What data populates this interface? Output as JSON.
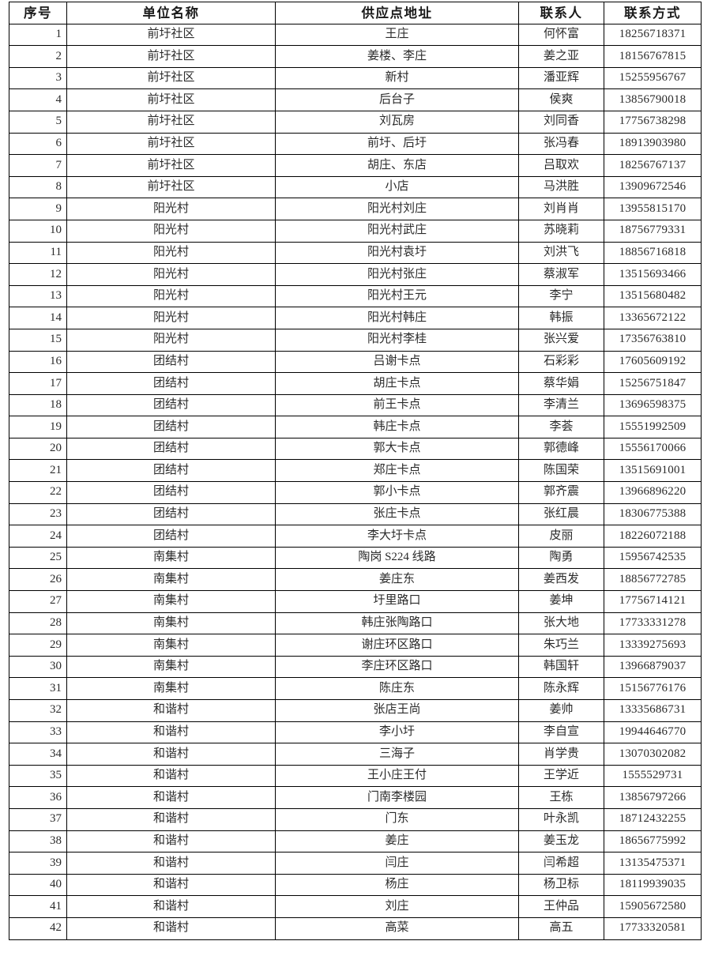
{
  "document": {
    "type": "table",
    "columns": [
      {
        "key": "seq",
        "label": "序号"
      },
      {
        "key": "unit",
        "label": "单位名称"
      },
      {
        "key": "addr",
        "label": "供应点地址"
      },
      {
        "key": "person",
        "label": "联系人"
      },
      {
        "key": "phone",
        "label": "联系方式"
      }
    ],
    "rows": [
      {
        "seq": "1",
        "unit": "前圩社区",
        "addr": "王庄",
        "person": "何怀富",
        "phone": "18256718371"
      },
      {
        "seq": "2",
        "unit": "前圩社区",
        "addr": "姜楼、李庄",
        "person": "姜之亚",
        "phone": "18156767815"
      },
      {
        "seq": "3",
        "unit": "前圩社区",
        "addr": "新村",
        "person": "潘亚辉",
        "phone": "15255956767"
      },
      {
        "seq": "4",
        "unit": "前圩社区",
        "addr": "后台子",
        "person": "侯爽",
        "phone": "13856790018"
      },
      {
        "seq": "5",
        "unit": "前圩社区",
        "addr": "刘瓦房",
        "person": "刘同香",
        "phone": "17756738298"
      },
      {
        "seq": "6",
        "unit": "前圩社区",
        "addr": "前圩、后圩",
        "person": "张冯春",
        "phone": "18913903980"
      },
      {
        "seq": "7",
        "unit": "前圩社区",
        "addr": "胡庄、东店",
        "person": "吕取欢",
        "phone": "18256767137"
      },
      {
        "seq": "8",
        "unit": "前圩社区",
        "addr": "小店",
        "person": "马洪胜",
        "phone": "13909672546"
      },
      {
        "seq": "9",
        "unit": "阳光村",
        "addr": "阳光村刘庄",
        "person": "刘肖肖",
        "phone": "13955815170"
      },
      {
        "seq": "10",
        "unit": "阳光村",
        "addr": "阳光村武庄",
        "person": "苏晓莉",
        "phone": "18756779331"
      },
      {
        "seq": "11",
        "unit": "阳光村",
        "addr": "阳光村袁圩",
        "person": "刘洪飞",
        "phone": "18856716818"
      },
      {
        "seq": "12",
        "unit": "阳光村",
        "addr": "阳光村张庄",
        "person": "蔡淑军",
        "phone": "13515693466"
      },
      {
        "seq": "13",
        "unit": "阳光村",
        "addr": "阳光村王元",
        "person": "李宁",
        "phone": "13515680482"
      },
      {
        "seq": "14",
        "unit": "阳光村",
        "addr": "阳光村韩庄",
        "person": "韩振",
        "phone": "13365672122"
      },
      {
        "seq": "15",
        "unit": "阳光村",
        "addr": "阳光村李桂",
        "person": "张兴爱",
        "phone": "17356763810"
      },
      {
        "seq": "16",
        "unit": "团结村",
        "addr": "吕谢卡点",
        "person": "石彩彩",
        "phone": "17605609192"
      },
      {
        "seq": "17",
        "unit": "团结村",
        "addr": "胡庄卡点",
        "person": "蔡华娟",
        "phone": "15256751847"
      },
      {
        "seq": "18",
        "unit": "团结村",
        "addr": "前王卡点",
        "person": "李清兰",
        "phone": "13696598375"
      },
      {
        "seq": "19",
        "unit": "团结村",
        "addr": "韩庄卡点",
        "person": "李荟",
        "phone": "15551992509"
      },
      {
        "seq": "20",
        "unit": "团结村",
        "addr": "郭大卡点",
        "person": "郭德峰",
        "phone": "15556170066"
      },
      {
        "seq": "21",
        "unit": "团结村",
        "addr": "郑庄卡点",
        "person": "陈国荣",
        "phone": "13515691001"
      },
      {
        "seq": "22",
        "unit": "团结村",
        "addr": "郭小卡点",
        "person": "郭齐震",
        "phone": "13966896220"
      },
      {
        "seq": "23",
        "unit": "团结村",
        "addr": "张庄卡点",
        "person": "张红晨",
        "phone": "18306775388"
      },
      {
        "seq": "24",
        "unit": "团结村",
        "addr": "李大圩卡点",
        "person": "皮丽",
        "phone": "18226072188"
      },
      {
        "seq": "25",
        "unit": "南集村",
        "addr": "陶岗 S224 线路",
        "person": "陶勇",
        "phone": "15956742535"
      },
      {
        "seq": "26",
        "unit": "南集村",
        "addr": "姜庄东",
        "person": "姜西发",
        "phone": "18856772785"
      },
      {
        "seq": "27",
        "unit": "南集村",
        "addr": "圩里路口",
        "person": "姜坤",
        "phone": "17756714121"
      },
      {
        "seq": "28",
        "unit": "南集村",
        "addr": "韩庄张陶路口",
        "person": "张大地",
        "phone": "17733331278"
      },
      {
        "seq": "29",
        "unit": "南集村",
        "addr": "谢庄环区路口",
        "person": "朱巧兰",
        "phone": "13339275693"
      },
      {
        "seq": "30",
        "unit": "南集村",
        "addr": "李庄环区路口",
        "person": "韩国轩",
        "phone": "13966879037"
      },
      {
        "seq": "31",
        "unit": "南集村",
        "addr": "陈庄东",
        "person": "陈永辉",
        "phone": "15156776176"
      },
      {
        "seq": "32",
        "unit": "和谐村",
        "addr": "张店王尚",
        "person": "姜帅",
        "phone": "13335686731"
      },
      {
        "seq": "33",
        "unit": "和谐村",
        "addr": "李小圩",
        "person": "李自宣",
        "phone": "19944646770"
      },
      {
        "seq": "34",
        "unit": "和谐村",
        "addr": "三海子",
        "person": "肖学贵",
        "phone": "13070302082"
      },
      {
        "seq": "35",
        "unit": "和谐村",
        "addr": "王小庄王付",
        "person": "王学近",
        "phone": "1555529731"
      },
      {
        "seq": "36",
        "unit": "和谐村",
        "addr": "门南李楼园",
        "person": "王栋",
        "phone": "13856797266"
      },
      {
        "seq": "37",
        "unit": "和谐村",
        "addr": "门东",
        "person": "叶永凯",
        "phone": "18712432255"
      },
      {
        "seq": "38",
        "unit": "和谐村",
        "addr": "姜庄",
        "person": "姜玉龙",
        "phone": "18656775992"
      },
      {
        "seq": "39",
        "unit": "和谐村",
        "addr": "闫庄",
        "person": "闫希超",
        "phone": "13135475371"
      },
      {
        "seq": "40",
        "unit": "和谐村",
        "addr": "杨庄",
        "person": "杨卫标",
        "phone": "18119939035"
      },
      {
        "seq": "41",
        "unit": "和谐村",
        "addr": "刘庄",
        "person": "王仲品",
        "phone": "15905672580"
      },
      {
        "seq": "42",
        "unit": "和谐村",
        "addr": "高菜",
        "person": "高五",
        "phone": "17733320581"
      }
    ]
  },
  "style": {
    "border_color": "#000000",
    "text_color": "#2b2b2b",
    "background": "#ffffff"
  }
}
